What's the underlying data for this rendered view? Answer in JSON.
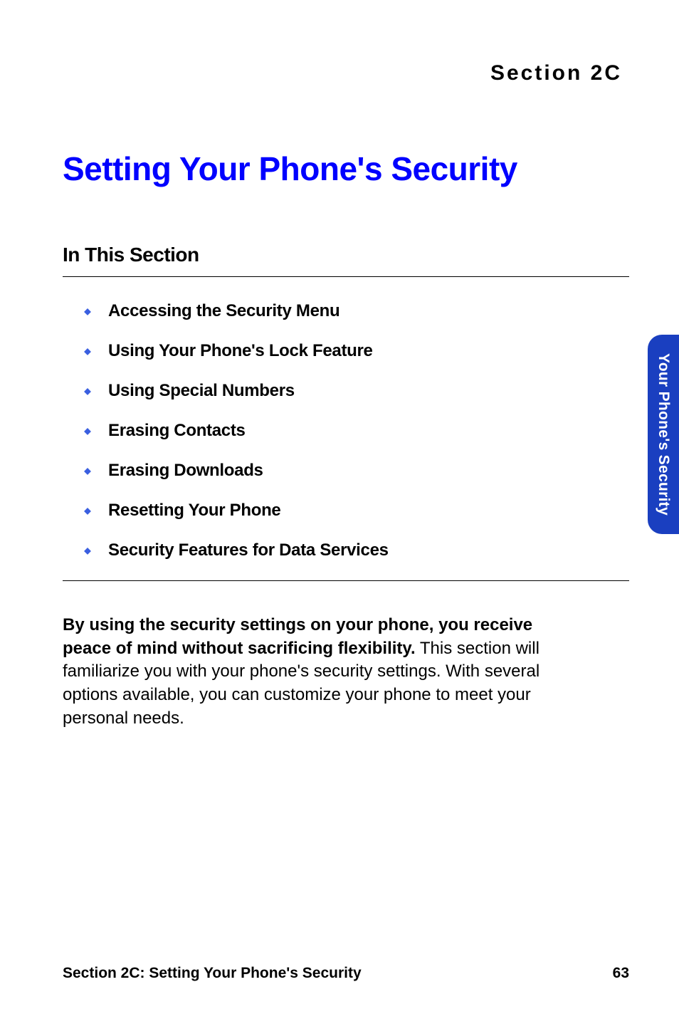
{
  "section_label": "Section 2C",
  "title": "Setting Your Phone's Security",
  "subheading": "In This Section",
  "toc": {
    "items": [
      {
        "label": "Accessing the Security Menu"
      },
      {
        "label": "Using Your Phone's Lock Feature"
      },
      {
        "label": "Using Special Numbers"
      },
      {
        "label": "Erasing Contacts"
      },
      {
        "label": "Erasing Downloads"
      },
      {
        "label": "Resetting Your Phone"
      },
      {
        "label": "Security Features for Data Services"
      }
    ]
  },
  "body": {
    "lead": "By using the security settings on your phone, you receive peace of mind without sacrificing flexibility.",
    "rest": " This section will familiarize you with your phone's security settings. With several options available, you can customize your phone to meet your personal needs."
  },
  "side_tab": "Your Phone's Security",
  "footer": {
    "left": "Section 2C: Setting Your Phone's Security",
    "page": "63"
  },
  "colors": {
    "link_blue": "#0000ff",
    "tab_blue": "#1a3fc0",
    "diamond": "#3a5fe0"
  }
}
